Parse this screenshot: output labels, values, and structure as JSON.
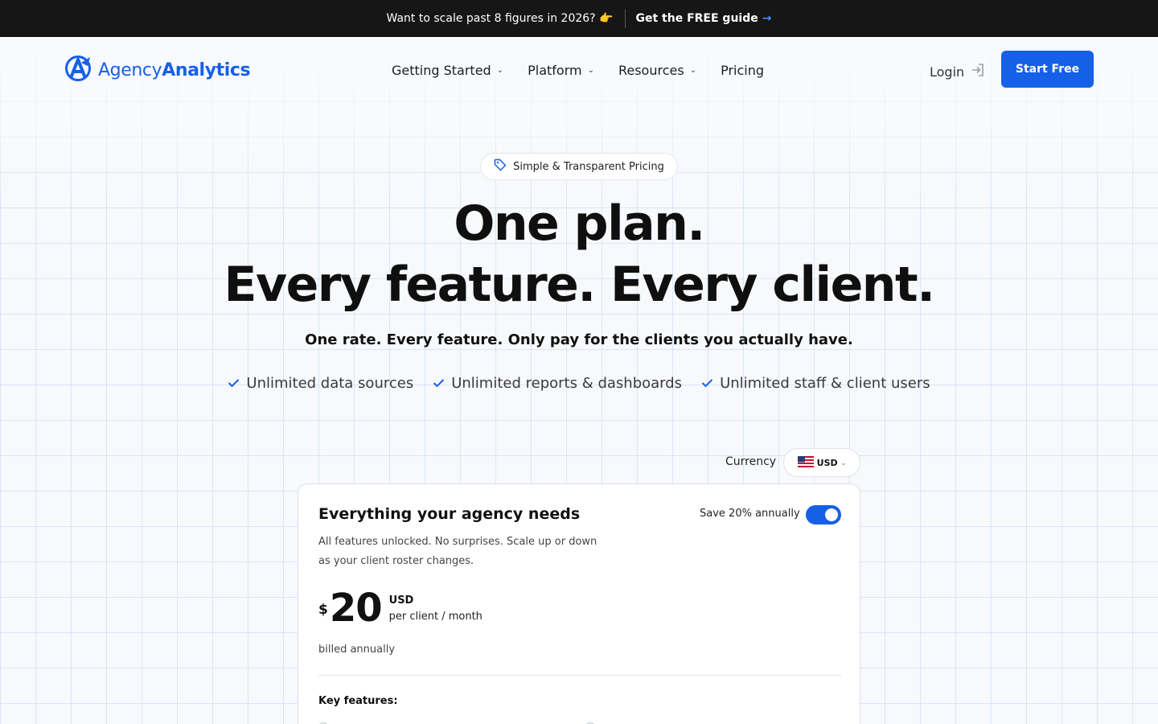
{
  "banner": {
    "message": "Want to scale past 8 figures in 2026? 👉",
    "cta": "Get the FREE guide"
  },
  "header": {
    "logo_part1": "Agency",
    "logo_part2": "Analytics",
    "nav": [
      {
        "label": "Getting Started",
        "has_dropdown": true
      },
      {
        "label": "Platform",
        "has_dropdown": true
      },
      {
        "label": "Resources",
        "has_dropdown": true
      },
      {
        "label": "Pricing",
        "has_dropdown": false
      }
    ],
    "login": "Login",
    "start_button": "Start Free"
  },
  "hero": {
    "pill": "Simple & Transparent Pricing",
    "headline_line1": "One plan.",
    "headline_line2": "Every feature. Every client.",
    "subline": "One rate. Every feature. Only pay for the clients you actually have.",
    "checks": [
      "Unlimited data sources",
      "Unlimited reports & dashboards",
      "Unlimited staff & client users"
    ]
  },
  "currency": {
    "label": "Currency",
    "selected": "USD"
  },
  "plan": {
    "title": "Everything your agency needs",
    "description": "All features unlocked. No surprises. Scale up or down as your client roster changes.",
    "save_label": "Save 20% annually",
    "annual_toggle_on": true,
    "currency_symbol": "$",
    "price": "20",
    "price_currency": "USD",
    "price_unit": "per client / month",
    "billing": "billed annually",
    "key_features_label": "Key features:"
  },
  "colors": {
    "brand": "#1660e8",
    "banner_bg": "#161616",
    "text": "#111111"
  }
}
